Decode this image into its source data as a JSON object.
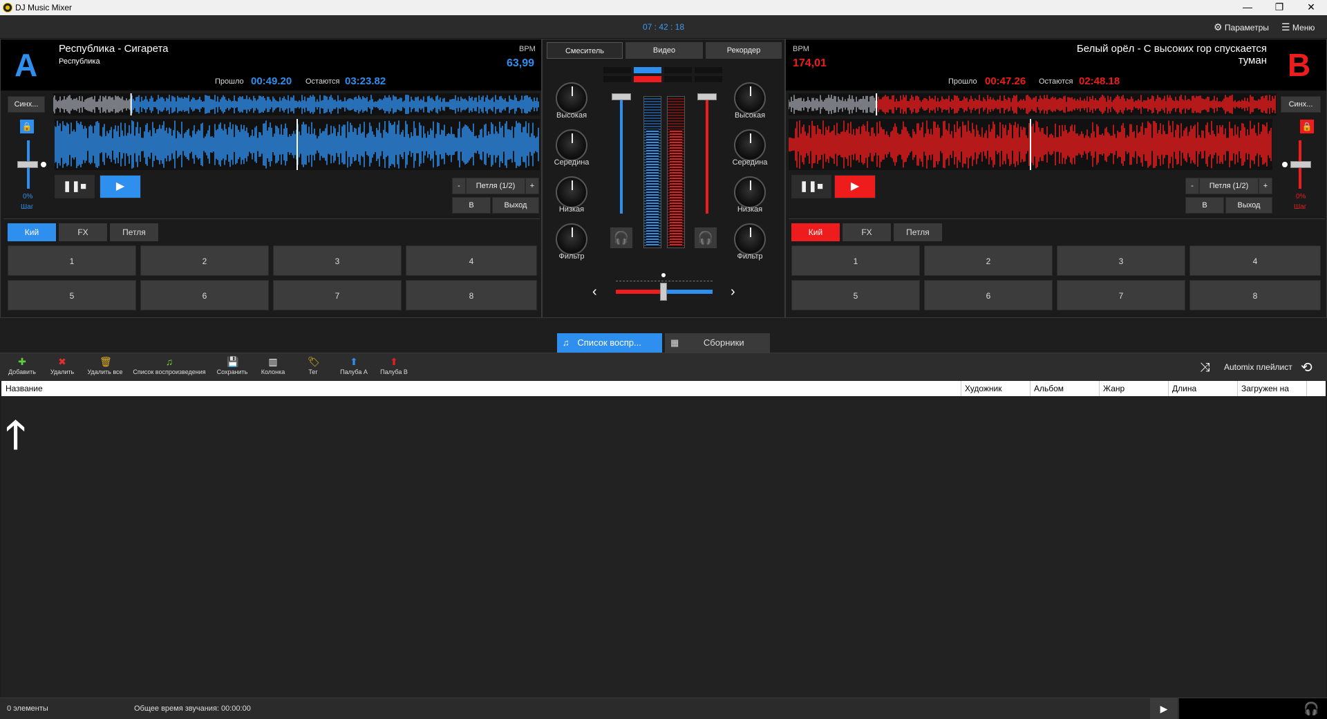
{
  "window": {
    "title": "DJ Music Mixer",
    "minimize": "—",
    "restore": "❐",
    "close": "✕"
  },
  "topbar": {
    "clock": "07 : 42 : 18",
    "settings_label": "Параметры",
    "menu_label": "Меню"
  },
  "deckA": {
    "letter": "A",
    "title": "Республика - Сигарета",
    "artist": "Республика",
    "bpm_label": "BPM",
    "bpm": "63,99",
    "elapsed_label": "Прошло",
    "elapsed": "00:49.20",
    "remaining_label": "Остаются",
    "remaining": "03:23.82",
    "sync_label": "Синх...",
    "pitch_value": "0%",
    "pitch_step": "Шаг",
    "loop_minus": "-",
    "loop_label": "Петля (1/2)",
    "loop_plus": "+",
    "in_label": "В",
    "out_label": "Выход",
    "tabs": [
      "Кий",
      "FX",
      "Петля"
    ],
    "pads": [
      "1",
      "2",
      "3",
      "4",
      "5",
      "6",
      "7",
      "8"
    ],
    "accent": "#2f8fef"
  },
  "deckB": {
    "letter": "B",
    "title": "Белый орёл - С высоких гор спускается туман",
    "bpm_label": "BPM",
    "bpm": "174,01",
    "elapsed_label": "Прошло",
    "elapsed": "00:47.26",
    "remaining_label": "Остаются",
    "remaining": "02:48.18",
    "sync_label": "Синх...",
    "pitch_value": "0%",
    "pitch_step": "Шаг",
    "loop_minus": "-",
    "loop_label": "Петля (1/2)",
    "loop_plus": "+",
    "in_label": "В",
    "out_label": "Выход",
    "tabs": [
      "Кий",
      "FX",
      "Петля"
    ],
    "pads": [
      "1",
      "2",
      "3",
      "4",
      "5",
      "6",
      "7",
      "8"
    ],
    "accent": "#ee1c1c"
  },
  "mixer": {
    "tabs": [
      "Смеситель",
      "Видео",
      "Рекордер"
    ],
    "knobs": [
      "Высокая",
      "Середина",
      "Низкая",
      "Фильтр"
    ]
  },
  "library": {
    "tabs": [
      "Список воспр...",
      "Сборники"
    ],
    "tools": [
      "Добавить",
      "Удалить",
      "Удалить все",
      "Список воспроизведения",
      "Сохранить",
      "Колонка",
      "Тег",
      "Палуба A",
      "Палуба B"
    ],
    "automix_label": "Automix плейлист",
    "columns": [
      "Название",
      "Художник",
      "Альбом",
      "Жанр",
      "Длина",
      "Загружен на"
    ]
  },
  "status": {
    "count": "0 элементы",
    "total_label": "Общее время звучания: 00:00:00"
  }
}
